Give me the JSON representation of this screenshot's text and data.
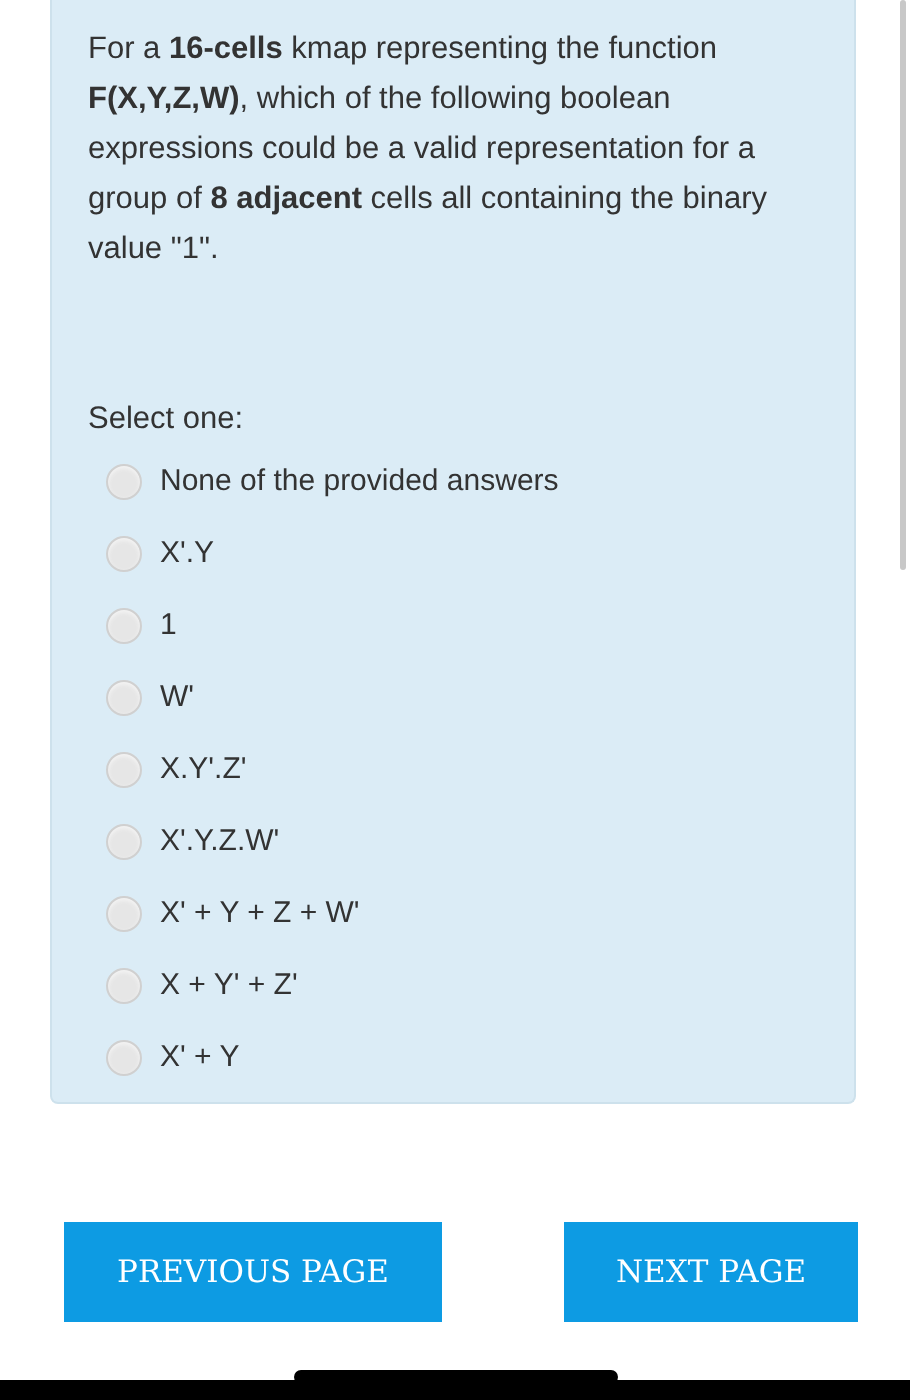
{
  "question": {
    "text": "For a **16-cells** kmap representing the function **F(X,Y,Z,W)**, which of the following boolean expressions could be a valid representation for a group of **8 adjacent** cells all containing the binary value \"1\".",
    "prompt": "Select one:",
    "options": [
      {
        "label": "None of the provided answers",
        "selected": false
      },
      {
        "label": "X'.Y",
        "selected": false
      },
      {
        "label": "1",
        "selected": false
      },
      {
        "label": "W'",
        "selected": false
      },
      {
        "label": "X.Y'.Z'",
        "selected": false
      },
      {
        "label": "X'.Y.Z.W'",
        "selected": false
      },
      {
        "label": "X' + Y + Z + W'",
        "selected": false
      },
      {
        "label": "X + Y' + Z'",
        "selected": false
      },
      {
        "label": "X' + Y",
        "selected": false
      }
    ]
  },
  "buttons": [
    "PREVIOUS PAGE",
    "NEXT PAGE"
  ]
}
